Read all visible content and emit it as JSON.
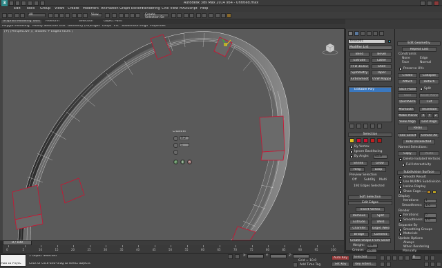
{
  "window": {
    "title": "Autodesk 3ds Max 2014 x64 - Untitled.max",
    "logo": "3"
  },
  "menu": [
    "Edit",
    "Tools",
    "Group",
    "Views",
    "Create",
    "Modifiers",
    "Animation",
    "Graph Editors",
    "Rendering",
    "Civil View",
    "MAXScript",
    "Help"
  ],
  "toolbar": {
    "selection_filter": "All",
    "view_dropdown": "View",
    "selection_set": "Create Selection Se"
  },
  "ribbon": {
    "tabs": [
      "Graphite Modeling Tools",
      "Freeform",
      "Selection",
      "Object Paint"
    ],
    "sub": [
      "Polygon Modeling",
      "Modify Selection",
      "Edit",
      "Geometry (All)",
      "Edges",
      "Loops",
      "Tris",
      "Subdivision",
      "Align",
      "Properties"
    ]
  },
  "viewport": {
    "label": "[+] [Perspective ] [ Shaded + Edged Faces ]"
  },
  "caddy": {
    "title": "Chamfer",
    "amount": "0.2",
    "segments": "1"
  },
  "command_panel": {
    "object_name": "Torus001",
    "modifier_list": "Modifier List",
    "buttons_left": [
      "Bend",
      "Bevel",
      "Extrude",
      "Lathe",
      "FFD 3x3x3",
      "Shell",
      "Symmetry",
      "Taper",
      "TurboSmooth",
      "UVW Mapping Clear"
    ],
    "stack_item": "Editable Poly",
    "selection_rollout": "Selection",
    "by_vertex": "By Vertex",
    "ignore_backfacing": "Ignore Backfacing",
    "by_angle": "By Angle:",
    "by_angle_value": "45.0",
    "shrink": "Shrink",
    "grow": "Grow",
    "ring": "Ring",
    "loop": "Loop",
    "preview_selection": "Preview Selection",
    "preview_off": "Off",
    "preview_subobj": "SubObj",
    "preview_multi": "Multi",
    "selected_status": "192 Edges Selected",
    "soft_selection": "Soft Selection",
    "edit_edges": "Edit Edges",
    "insert_vertex": "Insert Vertex",
    "remove": "Remove",
    "split": "Split",
    "extrude": "Extrude",
    "weld": "Weld",
    "chamfer": "Chamfer",
    "target_weld": "Target Weld",
    "bridge": "Bridge",
    "connect": "Connect",
    "create_shape": "Create Shape From Selection",
    "weight_label": "Weight:",
    "weight_value": "1.0",
    "crease_label": "Crease:",
    "crease_value": "0.0"
  },
  "command_panel2": {
    "edit_geometry": "Edit Geometry",
    "repeat_last": "Repeat Last",
    "constraints": "Constraints",
    "c_none": "None",
    "c_edge": "Edge",
    "c_face": "Face",
    "c_normal": "Normal",
    "preserve_uvs": "Preserve UVs",
    "create": "Create",
    "collapse": "Collapse",
    "attach": "Attach",
    "detach": "Detach",
    "slice_plane": "Slice Plane",
    "split": "Split",
    "slice": "Slice",
    "reset_plane": "Reset Plane",
    "quickslice": "QuickSlice",
    "cut": "Cut",
    "msmooth": "MSmooth",
    "tessellate": "Tessellate",
    "make_planar": "Make Planar",
    "x": "X",
    "y": "Y",
    "z": "Z",
    "view_align": "View Align",
    "grid_align": "Grid Align",
    "relax": "Relax",
    "hide_selected": "Hide Selected",
    "unhide_all": "Unhide All",
    "hide_unselected": "Hide Unselected",
    "named_selections": "Named Selections:",
    "copy": "Copy",
    "paste": "Paste",
    "delete_isolated": "Delete Isolated Vertices",
    "full_interactivity": "Full Interactivity",
    "subdivision_surface": "Subdivision Surface",
    "smooth_result": "Smooth Result",
    "use_nurms": "Use NURMS Subdivision",
    "isoline_display": "Isoline Display",
    "show_cage": "Show Cage......",
    "display": "Display",
    "iterations": "Iterations:",
    "iterations_value": "1",
    "smoothness": "Smoothness:",
    "smoothness_value": "1.0",
    "render": "Render",
    "render_iterations_value": "0",
    "render_smoothness_value": "1.0",
    "separate_by": "Separate By",
    "smoothing_groups": "Smoothing Groups",
    "materials": "Materials",
    "update_options": "Update Options",
    "always": "Always",
    "when_rendering": "When Rendering",
    "manually": "Manually"
  },
  "timeline": {
    "slider": "0 / 100",
    "ticks": [
      "0",
      "5",
      "10",
      "15",
      "20",
      "25",
      "30",
      "35",
      "40",
      "45",
      "50",
      "55",
      "60",
      "65",
      "70",
      "75",
      "80",
      "85",
      "90",
      "95",
      "100"
    ]
  },
  "status": {
    "maxscript": "Max to Physc",
    "selected": "1 Object Selected",
    "prompt": "Click or click-and-drag to select objects",
    "x_label": "X:",
    "y_label": "Y:",
    "z_label": "Z:",
    "grid": "Grid = 10.0",
    "auto_key": "Auto Key",
    "selected_dropdown": "Selected",
    "set_key": "Set Key",
    "key_filters": "Key Filters...",
    "add_time_tag": "Add Time Tag",
    "frame": "0"
  },
  "colors": {
    "viewport_bg": "#5a5a5a",
    "selected_edge": "#d01030",
    "accent_yellow": "#e0c020"
  }
}
